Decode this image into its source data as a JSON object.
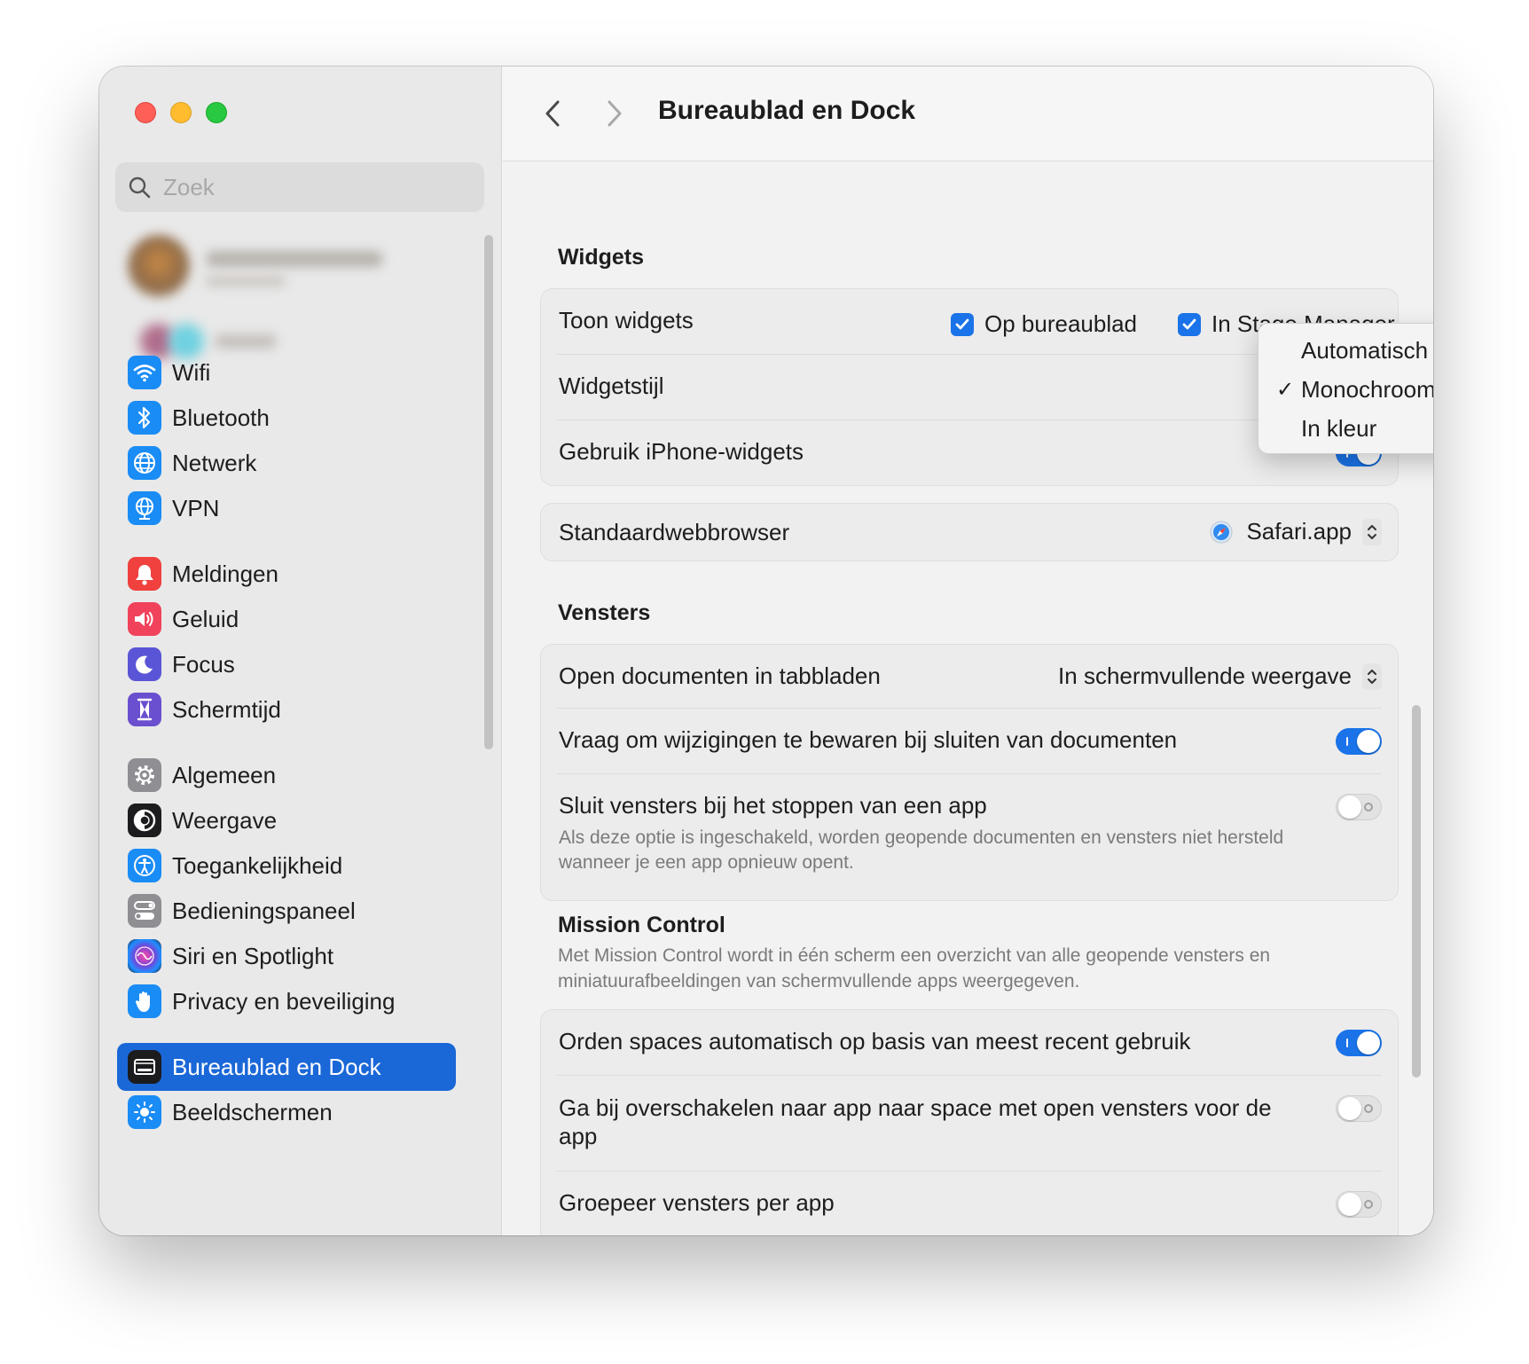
{
  "window": {
    "title": "Bureaublad en Dock"
  },
  "sidebar": {
    "search_placeholder": "Zoek",
    "items": [
      {
        "label": "Wifi",
        "icon": "wifi-icon",
        "color": "#1a8cf5"
      },
      {
        "label": "Bluetooth",
        "icon": "bluetooth-icon",
        "color": "#1a8cf5"
      },
      {
        "label": "Netwerk",
        "icon": "globe-icon",
        "color": "#1a8cf5"
      },
      {
        "label": "VPN",
        "icon": "vpn-globe-icon",
        "color": "#1a8cf5"
      },
      {
        "label": "Meldingen",
        "icon": "bell-icon",
        "color": "#f0413f"
      },
      {
        "label": "Geluid",
        "icon": "speaker-icon",
        "color": "#f0435b"
      },
      {
        "label": "Focus",
        "icon": "moon-icon",
        "color": "#5a55d6"
      },
      {
        "label": "Schermtijd",
        "icon": "hourglass-icon",
        "color": "#6a4fcf"
      },
      {
        "label": "Algemeen",
        "icon": "gear-icon",
        "color": "#8e8e93"
      },
      {
        "label": "Weergave",
        "icon": "appearance-icon",
        "color": "#1c1c1e"
      },
      {
        "label": "Toegankelijkheid",
        "icon": "accessibility-icon",
        "color": "#1a8cf5"
      },
      {
        "label": "Bedieningspaneel",
        "icon": "control-center-icon",
        "color": "#8e8e93"
      },
      {
        "label": "Siri en Spotlight",
        "icon": "siri-icon",
        "color": "#3a2d7a"
      },
      {
        "label": "Privacy en beveiliging",
        "icon": "hand-icon",
        "color": "#1a8cf5"
      },
      {
        "label": "Bureaublad en Dock",
        "icon": "dock-icon",
        "color": "#1c1c1e",
        "active": true
      },
      {
        "label": "Beeldschermen",
        "icon": "sun-icon",
        "color": "#1a8cf5"
      }
    ]
  },
  "widgets": {
    "section_title": "Widgets",
    "toon_label": "Toon widgets",
    "op_bureaublad": "Op bureaublad",
    "in_stage_manager": "In Stage Manager",
    "stijl_label": "Widgetstijl",
    "iphone_label": "Gebruik iPhone-widgets",
    "iphone_on": true
  },
  "widget_style_menu": {
    "options": [
      "Automatisch",
      "Monochroom",
      "In kleur"
    ],
    "selected": "Monochroom",
    "checkmark": "✓"
  },
  "browser": {
    "label": "Standaardwebbrowser",
    "value": "Safari.app"
  },
  "vensters": {
    "section_title": "Vensters",
    "open_docs_label": "Open documenten in tabbladen",
    "open_docs_value": "In schermvullende weergave",
    "ask_save_label": "Vraag om wijzigingen te bewaren bij sluiten van documenten",
    "ask_save_on": true,
    "close_windows_label": "Sluit vensters bij het stoppen van een app",
    "close_windows_desc": "Als deze optie is ingeschakeld, worden geopende documenten en vensters niet hersteld wanneer je een app opnieuw opent.",
    "close_windows_on": false
  },
  "mission_control": {
    "section_title": "Mission Control",
    "description": "Met Mission Control wordt in één scherm een overzicht van alle geopende vensters en miniatuurafbeeldingen van schermvullende apps weergegeven.",
    "auto_arrange_label": "Orden spaces automatisch op basis van meest recent gebruik",
    "auto_arrange_on": true,
    "switch_space_label": "Ga bij overschakelen naar app naar space met open vensters voor de app",
    "switch_space_on": false,
    "group_label": "Groepeer vensters per app",
    "group_on": false
  },
  "colors": {
    "accent": "#1a73e8",
    "selection": "#1a67d8"
  }
}
